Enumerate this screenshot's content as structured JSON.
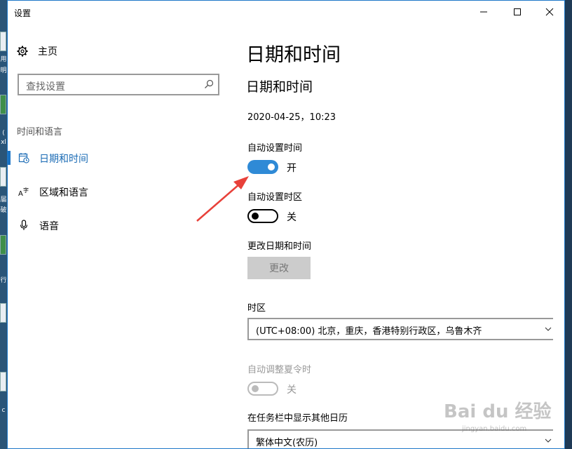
{
  "window": {
    "title": "设置"
  },
  "sidebar": {
    "home_label": "主页",
    "search_placeholder": "查找设置",
    "section_title": "时间和语言",
    "items": [
      {
        "label": "日期和时间",
        "icon": "calendar-clock-icon",
        "active": true
      },
      {
        "label": "区域和语言",
        "icon": "language-icon",
        "active": false
      },
      {
        "label": "语音",
        "icon": "microphone-icon",
        "active": false
      }
    ]
  },
  "main": {
    "page_title": "日期和时间",
    "section_title": "日期和时间",
    "current_datetime": "2020-04-25，10:23",
    "auto_time": {
      "label": "自动设置时间",
      "state": "开",
      "on": true
    },
    "auto_timezone": {
      "label": "自动设置时区",
      "state": "关",
      "on": false
    },
    "change_datetime": {
      "label": "更改日期和时间",
      "button": "更改"
    },
    "timezone": {
      "label": "时区",
      "value": "(UTC+08:00) 北京，重庆，香港特别行政区，乌鲁木齐"
    },
    "dst": {
      "label": "自动调整夏令时",
      "state": "关",
      "on": false,
      "disabled": true
    },
    "other_calendar": {
      "label": "在任务栏中显示其他日历",
      "value": "繁体中文(农历)"
    }
  },
  "watermark": {
    "brand": "Bai du 经验",
    "url": "jingyan.baidu.com"
  },
  "desktop_glyphs": [
    "用",
    "明",
    "(",
    "xl",
    "届",
    "破",
    "行",
    "c"
  ],
  "colors": {
    "accent": "#1a73c4",
    "toggle_on": "#2f8ad6",
    "arrow": "#e8413a"
  }
}
